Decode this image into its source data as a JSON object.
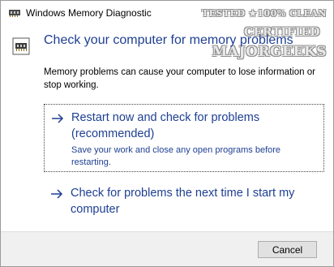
{
  "window": {
    "title": "Windows Memory Diagnostic",
    "icon": "memory-chip-icon"
  },
  "watermark": {
    "line1": "TESTED ★100% CLEAN",
    "line2": "CERTIFIED",
    "line3": "MAJORGEEKS"
  },
  "header": {
    "icon": "memory-chip-icon",
    "heading": "Check your computer for memory problems",
    "description": "Memory problems can cause your computer to lose information or stop working."
  },
  "options": [
    {
      "icon": "arrow-right-icon",
      "title": "Restart now and check for problems (recommended)",
      "note": "Save your work and close any open programs before restarting."
    },
    {
      "icon": "arrow-right-icon",
      "title": "Check for problems the next time I start my computer"
    }
  ],
  "footer": {
    "cancel_label": "Cancel"
  },
  "colors": {
    "link": "#1e3f92",
    "footer_bg": "#f0f0f0",
    "button_bg": "#e1e1e1"
  }
}
